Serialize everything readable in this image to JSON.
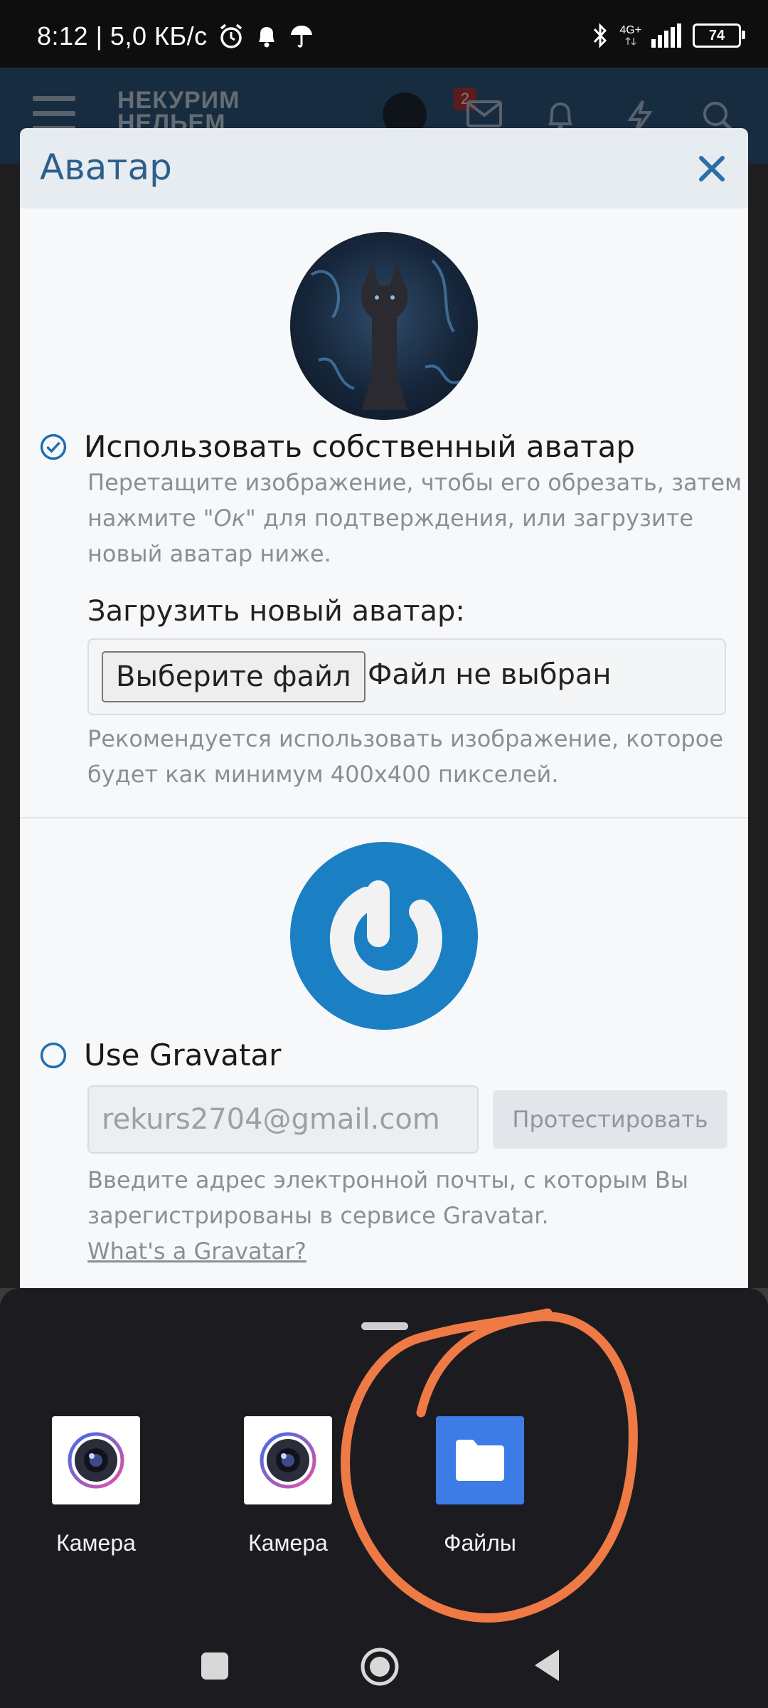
{
  "status_bar": {
    "time_speed": "8:12 | 5,0 КБ/с",
    "network": "4G+",
    "battery": "74"
  },
  "site_header": {
    "logo_line1": "НЕКУРИМ",
    "logo_line2": "НЕЛЬЕМ",
    "notifications_badge": "2"
  },
  "dialog": {
    "title": "Аватар",
    "own_avatar": {
      "label": "Использовать собственный аватар",
      "desc_part1": "Перетащите изображение, чтобы его обрезать, затем нажмите \"",
      "desc_em": "Ок",
      "desc_part2": "\" для подтверждения, или загрузите новый аватар ниже.",
      "upload_label": "Загрузить новый аватар:",
      "file_button": "Выберите файл",
      "file_status": "Файл не выбран",
      "recommend": "Рекомендуется использовать изображение, которое будет как минимум 400x400 пикселей."
    },
    "gravatar": {
      "label": "Use Gravatar",
      "email_value": "rekurs2704@gmail.com",
      "test_button": "Протестировать",
      "desc": "Введите адрес электронной почты, с которым Вы зарегистрированы в сервисе Gravatar.",
      "link": "What's a Gravatar?"
    }
  },
  "chooser": {
    "apps": [
      {
        "label": "Камера",
        "icon": "camera-icon"
      },
      {
        "label": "Камера",
        "icon": "camera-icon"
      },
      {
        "label": "Файлы",
        "icon": "folder-icon"
      }
    ]
  },
  "colors": {
    "accent": "#1f6fb2",
    "annotation": "#f07a45",
    "sheet_bg": "#1c1c20"
  }
}
